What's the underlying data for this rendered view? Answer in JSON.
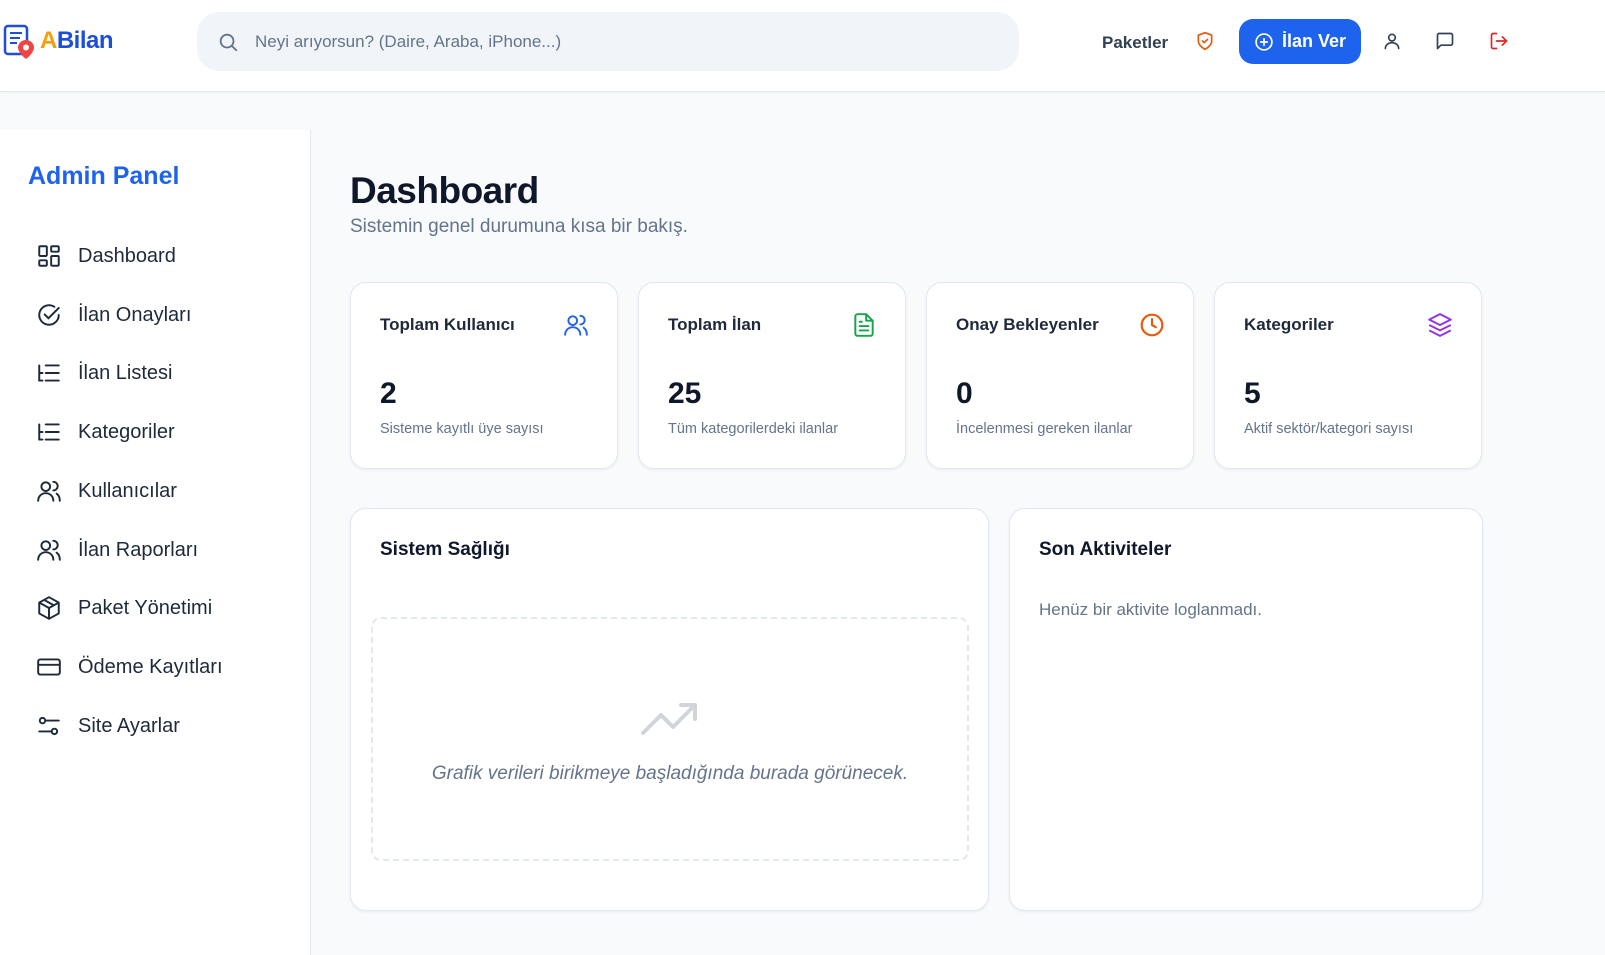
{
  "header": {
    "logo": {
      "accent": "A",
      "rest": "Bilan"
    },
    "search_placeholder": "Neyi arıyorsun? (Daire, Araba, iPhone...)",
    "packages_label": "Paketler",
    "post_ad_label": "İlan Ver",
    "icons": [
      "search-icon",
      "shield-icon",
      "plus-circle-icon",
      "user-icon",
      "message-icon",
      "logout-icon"
    ]
  },
  "sidebar": {
    "title": "Admin Panel",
    "items": [
      {
        "label": "Dashboard",
        "icon": "grid-icon"
      },
      {
        "label": "İlan Onayları",
        "icon": "check-circle-icon"
      },
      {
        "label": "İlan Listesi",
        "icon": "list-tree-icon"
      },
      {
        "label": "Kategoriler",
        "icon": "list-tree-icon"
      },
      {
        "label": "Kullanıcılar",
        "icon": "users-icon"
      },
      {
        "label": "İlan Raporları",
        "icon": "users-icon"
      },
      {
        "label": "Paket Yönetimi",
        "icon": "box-icon"
      },
      {
        "label": "Ödeme Kayıtları",
        "icon": "credit-card-icon"
      },
      {
        "label": "Site Ayarlar",
        "icon": "sliders-icon"
      }
    ]
  },
  "main": {
    "title": "Dashboard",
    "subtitle": "Sistemin genel durumuna kısa bir bakış.",
    "stats": [
      {
        "label": "Toplam Kullanıcı",
        "value": "2",
        "desc": "Sisteme kayıtlı üye sayısı",
        "icon": "users-icon",
        "color": "#2563eb"
      },
      {
        "label": "Toplam İlan",
        "value": "25",
        "desc": "Tüm kategorilerdeki ilanlar",
        "icon": "file-text-icon",
        "color": "#16a34a"
      },
      {
        "label": "Onay Bekleyenler",
        "value": "0",
        "desc": "İncelenmesi gereken ilanlar",
        "icon": "clock-icon",
        "color": "#ea580c"
      },
      {
        "label": "Kategoriler",
        "value": "5",
        "desc": "Aktif sektör/kategori sayısı",
        "icon": "layers-icon",
        "color": "#9333ea"
      }
    ],
    "system_health": {
      "title": "Sistem Sağlığı",
      "empty_text": "Grafik verileri birikmeye başladığında burada görünecek."
    },
    "recent_activity": {
      "title": "Son Aktiviteler",
      "empty_text": "Henüz bir aktivite loglanmadı."
    }
  },
  "colors": {
    "primary": "#1d63ed",
    "logout": "#dc2626",
    "shield": "#ea580c"
  }
}
